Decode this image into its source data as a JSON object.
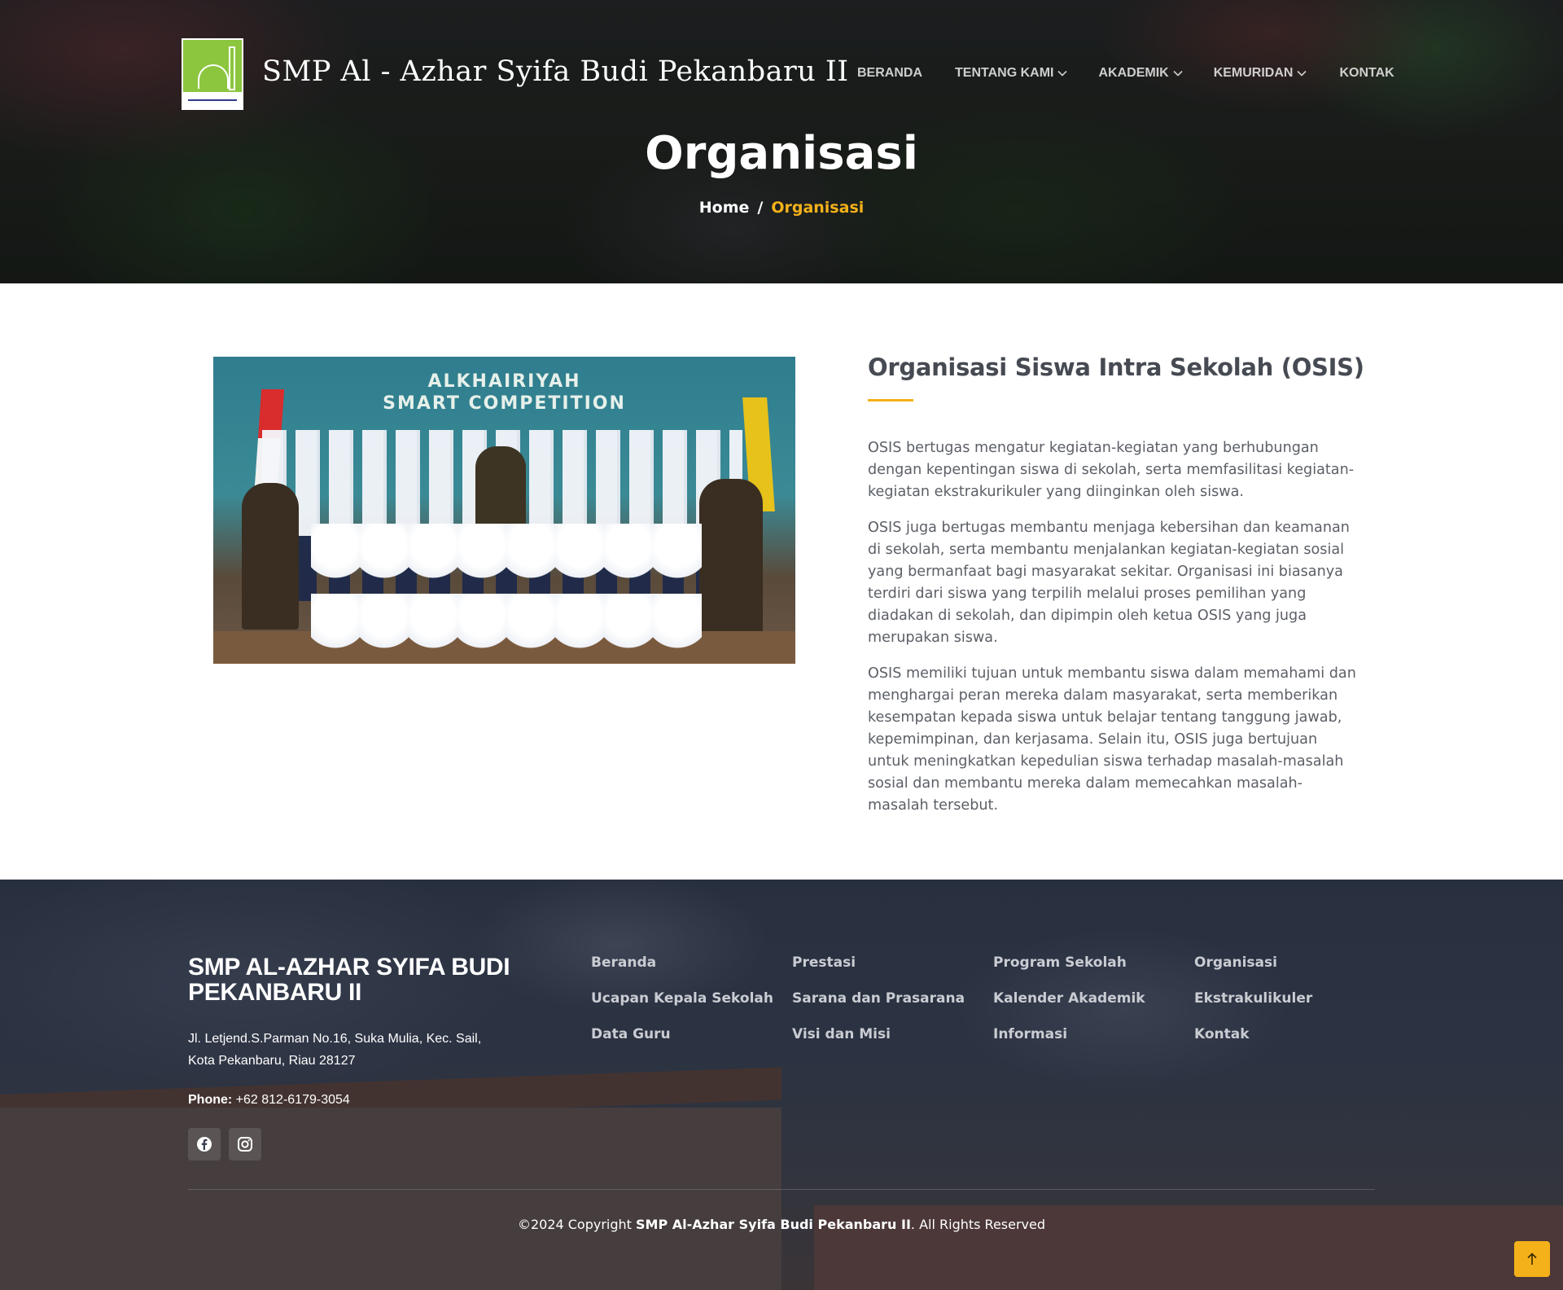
{
  "header": {
    "site_title": "SMP Al - Azhar Syifa Budi Pekanbaru II",
    "logo_caption": "Al-Azhar Syifa Budi Pekanbaru II",
    "nav": [
      {
        "label": "BERANDA",
        "dropdown": false
      },
      {
        "label": "TENTANG KAMI",
        "dropdown": true
      },
      {
        "label": "AKADEMIK",
        "dropdown": true
      },
      {
        "label": "KEMURIDAN",
        "dropdown": true
      },
      {
        "label": "KONTAK",
        "dropdown": false
      }
    ]
  },
  "hero": {
    "title": "Organisasi",
    "breadcrumb": {
      "home": "Home",
      "separator": "/",
      "current": "Organisasi"
    }
  },
  "photo": {
    "banner_line1": "ALKHAIRIYAH",
    "banner_line2": "SMART COMPETITION"
  },
  "content": {
    "heading": "Organisasi Siswa Intra Sekolah (OSIS)",
    "paragraphs": [
      "OSIS bertugas mengatur kegiatan-kegiatan yang berhubungan dengan kepentingan siswa di sekolah, serta memfasilitasi kegiatan-kegiatan ekstrakurikuler yang diinginkan oleh siswa.",
      "OSIS juga bertugas membantu menjaga kebersihan dan keamanan di sekolah, serta membantu menjalankan kegiatan-kegiatan sosial yang bermanfaat bagi masyarakat sekitar. Organisasi ini biasanya terdiri dari siswa yang terpilih melalui proses pemilihan yang diadakan di sekolah, dan dipimpin oleh ketua OSIS yang juga merupakan siswa.",
      "OSIS memiliki tujuan untuk membantu siswa dalam memahami dan menghargai peran mereka dalam masyarakat, serta memberikan kesempatan kepada siswa untuk belajar tentang tanggung jawab, kepemimpinan, dan kerjasama. Selain itu, OSIS juga bertujuan untuk meningkatkan kepedulian siswa terhadap masalah-masalah sosial dan membantu mereka dalam memecahkan masalah-masalah tersebut."
    ]
  },
  "footer": {
    "brand": "SMP AL-AZHAR SYIFA BUDI PEKANBARU II",
    "address_line1": "Jl. Letjend.S.Parman No.16, Suka Mulia, Kec. Sail,",
    "address_line2": "Kota Pekanbaru, Riau 28127",
    "phone_label": "Phone:",
    "phone_value": "+62 812-6179-3054",
    "socials": [
      "facebook-icon",
      "instagram-icon"
    ],
    "links": [
      "Beranda",
      "Prestasi",
      "Program Sekolah",
      "Organisasi",
      "Ucapan Kepala Sekolah",
      "Sarana dan Prasarana",
      "Kalender Akademik",
      "Ekstrakulikuler",
      "Data Guru",
      "Visi dan Misi",
      "Informasi",
      "Kontak"
    ],
    "copyright_prefix": "©2024 Copyright",
    "copyright_name": "SMP Al-Azhar Syifa Budi Pekanbaru II",
    "copyright_suffix": ". All Rights Reserved"
  },
  "colors": {
    "accent": "#f5b11a",
    "heading": "#464a52",
    "body_text": "#5b5f66",
    "logo_green": "#8cc63f"
  }
}
